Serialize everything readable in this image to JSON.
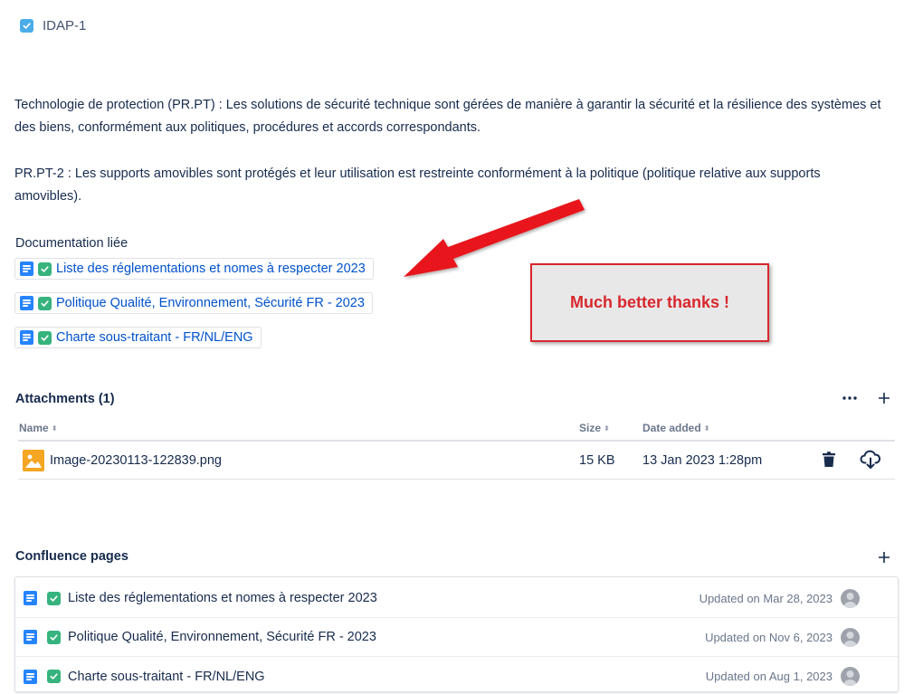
{
  "issue": {
    "key": "IDAP-1"
  },
  "description": {
    "paragraph1": "Technologie de protection (PR.PT) : Les solutions de sécurité technique sont gérées de manière à garantir la sécurité et la résilience des systèmes et des biens, conformément aux politiques, procédures et accords correspondants.",
    "paragraph2": "PR.PT-2 : Les supports amovibles sont protégés et leur utilisation est restreinte conformément à la politique (politique relative aux supports amovibles)."
  },
  "documentation": {
    "heading": "Documentation liée",
    "links": [
      {
        "label": "Liste des réglementations et nomes à respecter 2023"
      },
      {
        "label": "Politique Qualité, Environnement, Sécurité FR - 2023"
      },
      {
        "label": "Charte sous-traitant - FR/NL/ENG"
      }
    ]
  },
  "annotation": {
    "callout_text": "Much better thanks !",
    "arrow_color": "#e8151b",
    "callout_border_color": "#d9272e"
  },
  "attachments": {
    "heading": "Attachments (1)",
    "columns": {
      "name": "Name",
      "size": "Size",
      "date": "Date added"
    },
    "rows": [
      {
        "name": "Image-20230113-122839.png",
        "size": "15 KB",
        "date": "13 Jan 2023 1:28pm",
        "icon": "image-file-icon"
      }
    ],
    "actions": [
      "more-icon",
      "add-icon"
    ]
  },
  "confluence": {
    "heading": "Confluence pages",
    "pages": [
      {
        "title": "Liste des réglementations et nomes à respecter 2023",
        "updated": "Updated on Mar 28, 2023"
      },
      {
        "title": "Politique Qualité, Environnement, Sécurité FR - 2023",
        "updated": "Updated on Nov 6, 2023"
      },
      {
        "title": "Charte sous-traitant - FR/NL/ENG",
        "updated": "Updated on Aug 1, 2023"
      }
    ]
  },
  "colors": {
    "link": "#0052cc",
    "page_icon": "#2684ff",
    "check_green": "#36b37e",
    "check_blue": "#4bade8",
    "image_icon": "#f5a623"
  }
}
